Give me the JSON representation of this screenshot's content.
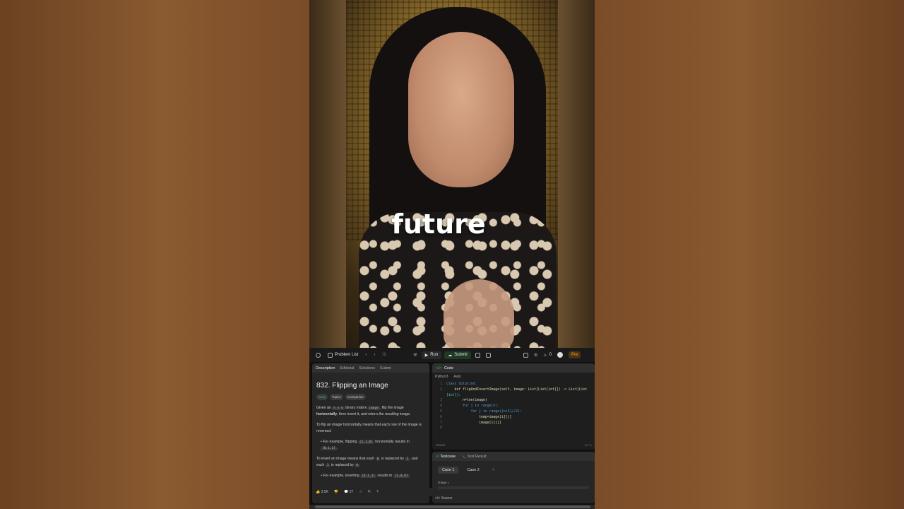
{
  "video": {
    "caption": "future"
  },
  "topbar": {
    "problem_list": "Problem List",
    "run": "Run",
    "submit": "Submit",
    "likes_count": "0",
    "premium": "Pre"
  },
  "left_panel": {
    "tabs": [
      "Description",
      "Editorial",
      "Solutions",
      "Submi"
    ],
    "title": "832. Flipping an Image",
    "badges": [
      "Easy",
      "Topics",
      "Companies"
    ],
    "p1_a": "Given an",
    "p1_code1": "n x n",
    "p1_b": "binary matrix",
    "p1_code2": "image",
    "p1_c": ", flip the image",
    "p1_d": "horizontally",
    "p1_e": ", then invert it, and return",
    "p1_f": "the resulting image",
    "p2": "To flip an image horizontally means that each row of the image is reversed.",
    "b1_a": "For example, flipping",
    "b1_code1": "[1,1,0]",
    "b1_b": "horizontally results in",
    "b1_code2": "[0,1,1]",
    "p3_a": "To invert an image means that each",
    "p3_code1": "0",
    "p3_b": "is replaced by",
    "p3_code2": "1",
    "p3_c": ", and each",
    "p3_code3": "1",
    "p3_d": "is replaced by",
    "p3_code4": "0",
    "b2_a": "For example, inverting",
    "b2_code1": "[0,1,1]",
    "b2_b": "results in",
    "b2_code2": "[1,0,0]",
    "likes": "3.5K",
    "comments": "27"
  },
  "code_panel": {
    "tab": "Code",
    "language": "Python3",
    "mode": "Auto",
    "lines": [
      "class Solution:",
      "    def flipAndInvertImage(self, image: List[List[int]]) -> List[List",
      "[int]]:",
      "        n=len(image)",
      "        for i in range(n):",
      "            for j in range((n+1)//2):",
      "                temp=image[i][j]",
      "                image[i][j]",
      ""
    ],
    "line_numbers": [
      "1",
      "2",
      "",
      "3",
      "4",
      "5",
      "6",
      "7",
      "8"
    ],
    "saved": "Saved",
    "position": "Ln 7,"
  },
  "testcase_panel": {
    "tabs": [
      "Testcase",
      "Test Result"
    ],
    "cases": [
      "Case 1",
      "Case 2"
    ],
    "add": "+",
    "variable": "image =",
    "source": "Source"
  },
  "colors": {
    "accent_green": "#2cbb5d",
    "accent_orange": "#ffa116",
    "panel_bg": "#262626"
  }
}
